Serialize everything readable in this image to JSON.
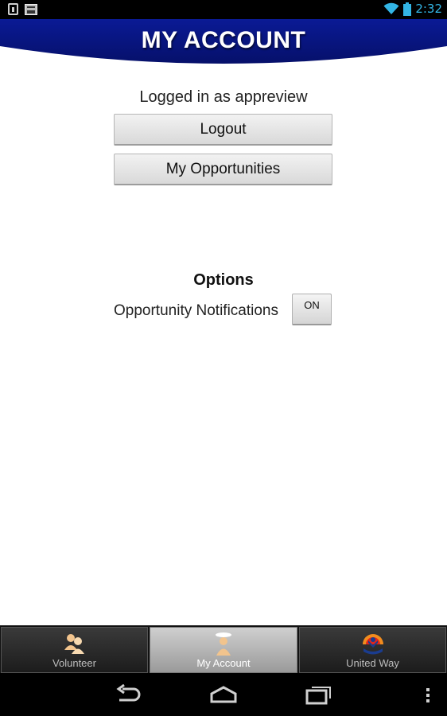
{
  "status_bar": {
    "time": "2:32",
    "icons": [
      "download-icon",
      "news-icon",
      "wifi-icon",
      "battery-icon"
    ]
  },
  "header": {
    "title": "MY ACCOUNT",
    "color": "#0b1a8c"
  },
  "account": {
    "logged_in_text": "Logged in as appreview",
    "logout_label": "Logout",
    "my_opportunities_label": "My Opportunities"
  },
  "options": {
    "title": "Options",
    "notifications_label": "Opportunity Notifications",
    "notifications_toggle": "ON"
  },
  "tabs": [
    {
      "label": "Volunteer",
      "icon": "volunteers-icon",
      "selected": false
    },
    {
      "label": "My Account",
      "icon": "account-person-icon",
      "selected": true
    },
    {
      "label": "United Way",
      "icon": "united-way-logo-icon",
      "selected": false
    }
  ],
  "nav_bar": {
    "buttons": [
      "back-icon",
      "home-icon",
      "recents-icon",
      "menu-icon"
    ]
  }
}
